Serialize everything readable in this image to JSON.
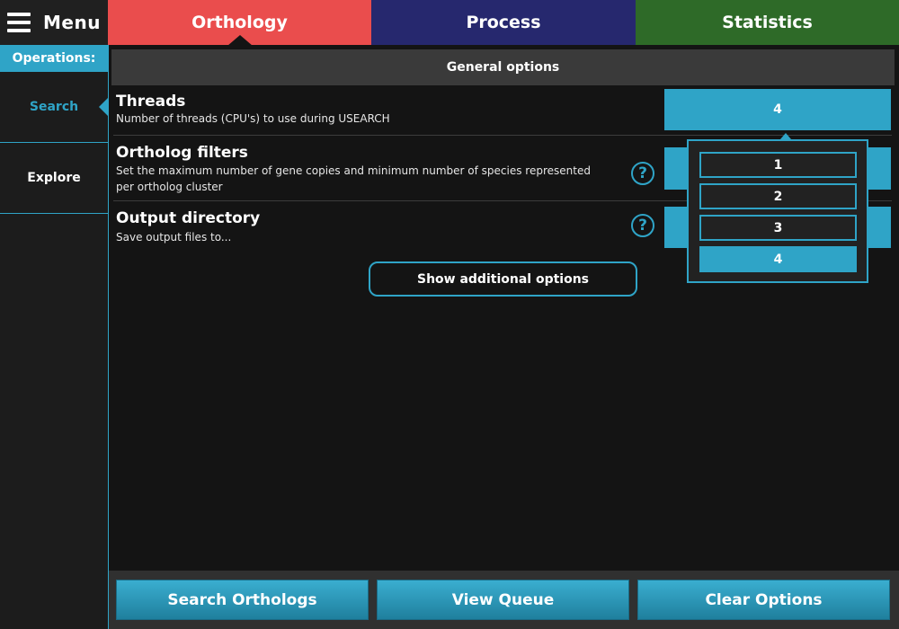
{
  "menu": {
    "label": "Menu"
  },
  "tabs": [
    {
      "label": "Orthology",
      "color": "#ea4d4d",
      "active": true
    },
    {
      "label": "Process",
      "color": "#26286e"
    },
    {
      "label": "Statistics",
      "color": "#2e6a28"
    }
  ],
  "sidebar": {
    "header": "Operations:",
    "items": [
      {
        "label": "Search",
        "active": true
      },
      {
        "label": "Explore"
      }
    ]
  },
  "main": {
    "section_header": "General options",
    "options": [
      {
        "title": "Threads",
        "description": "Number of threads (CPU's) to use during USEARCH",
        "value": "4"
      },
      {
        "title": "Ortholog filters",
        "description": "Set the maximum number of gene copies and minimum number of species represented per ortholog cluster",
        "help_icon": "question-mark-icon"
      },
      {
        "title": "Output directory",
        "description": "Save output files to...",
        "help_icon": "question-mark-icon"
      }
    ],
    "show_more_label": "Show additional options"
  },
  "threads_dropdown": {
    "options": [
      "1",
      "2",
      "3",
      "4"
    ],
    "selected": "4"
  },
  "actions": {
    "search": "Search Orthologs",
    "queue": "View Queue",
    "clear": "Clear Options"
  },
  "colors": {
    "accent": "#2fa4c7",
    "background": "#141414"
  }
}
